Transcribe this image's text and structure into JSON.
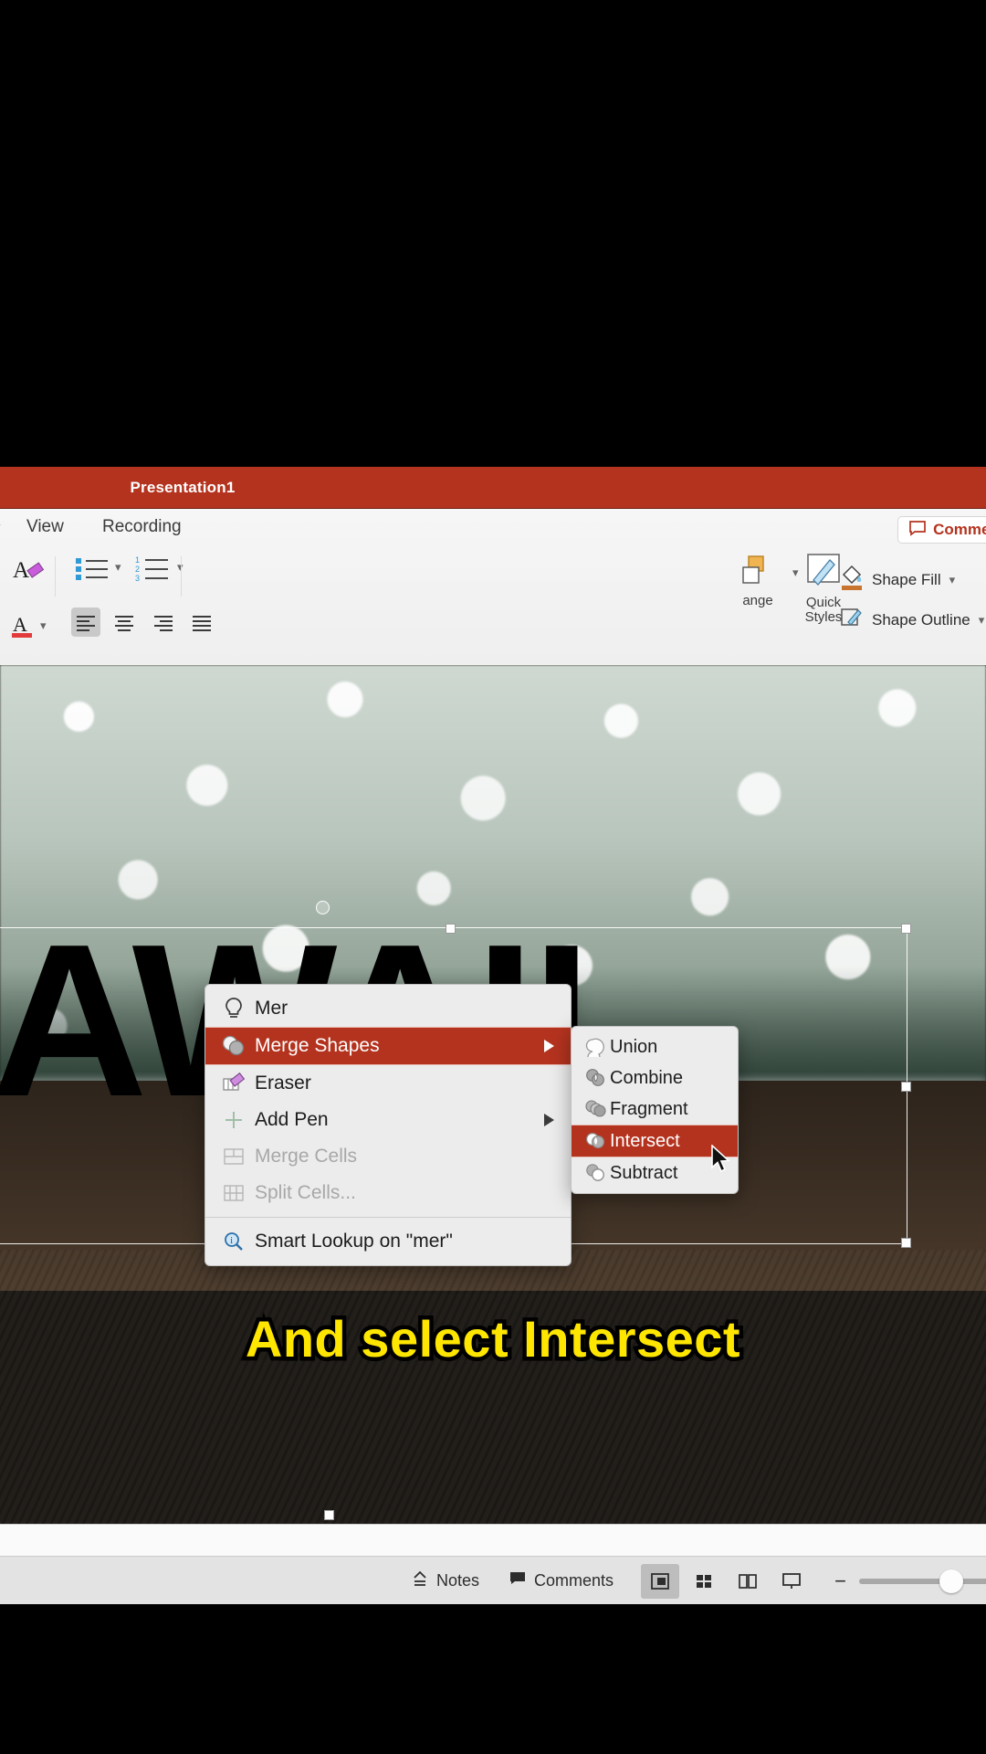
{
  "window": {
    "title": "Presentation1",
    "accent_color": "#b4331f"
  },
  "ribbon": {
    "tabs": [
      {
        "label": "View"
      },
      {
        "label": "Recording"
      }
    ],
    "comments_button": {
      "label": "Comments",
      "icon": "comment-bubble-icon"
    },
    "groups": {
      "arrange_label": "ange",
      "quick_styles_label_line1": "Quick",
      "quick_styles_label_line2": "Styles",
      "shape_fill_label": "Shape Fill",
      "shape_outline_label": "Shape Outline"
    }
  },
  "context_menu": {
    "items": [
      {
        "label": "Mer",
        "icon": "lightbulb-icon",
        "state": "normal",
        "submenu": false
      },
      {
        "label": "Merge Shapes",
        "icon": "merge-shapes-icon",
        "state": "selected",
        "submenu": true
      },
      {
        "label": "Eraser",
        "icon": "eraser-icon",
        "state": "normal",
        "submenu": false
      },
      {
        "label": "Add Pen",
        "icon": "plus-icon",
        "state": "normal",
        "submenu": true
      },
      {
        "label": "Merge Cells",
        "icon": "merge-cells-icon",
        "state": "disabled",
        "submenu": false
      },
      {
        "label": "Split Cells...",
        "icon": "split-cells-icon",
        "state": "disabled",
        "submenu": false
      }
    ],
    "footer_item": {
      "label": "Smart Lookup on \"mer\"",
      "icon": "smart-lookup-icon"
    }
  },
  "submenu": {
    "items": [
      {
        "label": "Union",
        "icon": "union-icon",
        "state": "normal"
      },
      {
        "label": "Combine",
        "icon": "combine-icon",
        "state": "normal"
      },
      {
        "label": "Fragment",
        "icon": "fragment-icon",
        "state": "normal"
      },
      {
        "label": "Intersect",
        "icon": "intersect-icon",
        "state": "selected"
      },
      {
        "label": "Subtract",
        "icon": "subtract-icon",
        "state": "normal"
      }
    ]
  },
  "slide": {
    "title_text": "AWAII",
    "caption_text": "And select Intersect",
    "caption_color": "#ffe600"
  },
  "status_bar": {
    "notes_label": "Notes",
    "comments_label": "Comments",
    "views": [
      {
        "name": "normal-view",
        "active": true
      },
      {
        "name": "slide-sorter-view",
        "active": false
      },
      {
        "name": "reading-view",
        "active": false
      },
      {
        "name": "slideshow-view",
        "active": false
      }
    ],
    "zoom_out_label": "−",
    "zoom_in_label": "+"
  }
}
